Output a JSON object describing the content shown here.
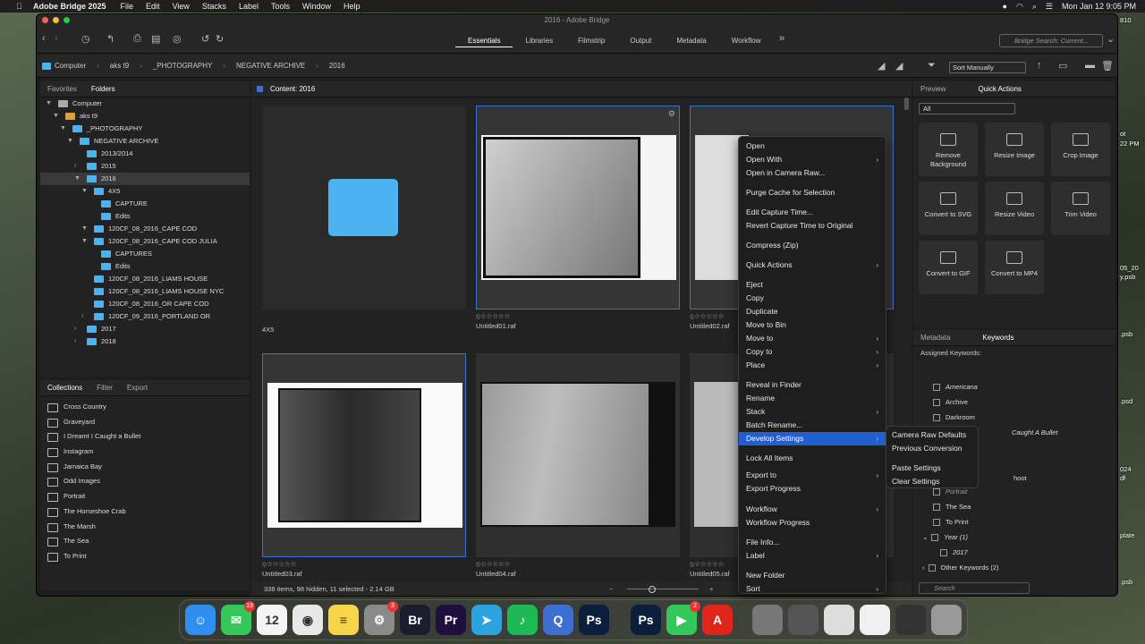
{
  "menubar": {
    "app_name": "Adobe Bridge 2025",
    "items": [
      "File",
      "Edit",
      "View",
      "Stacks",
      "Label",
      "Tools",
      "Window",
      "Help"
    ],
    "clock": "Mon Jan 12  9:05 PM"
  },
  "window": {
    "title": "2016 - Adobe Bridge"
  },
  "workspaces": [
    "Essentials",
    "Libraries",
    "Filmstrip",
    "Output",
    "Metadata",
    "Workflow"
  ],
  "search_placeholder": "Bridge Search: Current...",
  "breadcrumbs": [
    "Computer",
    "aks t9",
    "_PHOTOGRAPHY",
    "NEGATIVE ARCHIVE",
    "2016"
  ],
  "sort": {
    "label": "Sort Manually"
  },
  "left_tabs": [
    "Favorites",
    "Folders"
  ],
  "folders": [
    {
      "label": "Computer",
      "level": 0,
      "twisty": "▼"
    },
    {
      "label": "aks t9",
      "level": 1,
      "twisty": "▼"
    },
    {
      "label": "_PHOTOGRAPHY",
      "level": 2,
      "twisty": "▼"
    },
    {
      "label": "NEGATIVE ARCHIVE",
      "level": 3,
      "twisty": "▼"
    },
    {
      "label": "2013/2014",
      "level": 4,
      "twisty": ""
    },
    {
      "label": "2015",
      "level": 4,
      "twisty": "›"
    },
    {
      "label": "2016",
      "level": 4,
      "twisty": "▼",
      "selected": true
    },
    {
      "label": "4X5",
      "level": 5,
      "twisty": "▼"
    },
    {
      "label": "CAPTURE",
      "level": 6,
      "twisty": ""
    },
    {
      "label": "Edits",
      "level": 6,
      "twisty": ""
    },
    {
      "label": "120CF_08_2016_CAPE COD",
      "level": 5,
      "twisty": "▼"
    },
    {
      "label": "120CF_08_2016_CAPE COD JULIA",
      "level": 5,
      "twisty": "▼"
    },
    {
      "label": "CAPTURES",
      "level": 6,
      "twisty": ""
    },
    {
      "label": "Edits",
      "level": 6,
      "twisty": ""
    },
    {
      "label": "120CF_08_2016_LIAMS HOUSE",
      "level": 5,
      "twisty": ""
    },
    {
      "label": "120CF_08_2016_LIAMS HOUSE NYC",
      "level": 5,
      "twisty": ""
    },
    {
      "label": "120CF_08_2016_OR CAPE COD",
      "level": 5,
      "twisty": ""
    },
    {
      "label": "120CF_09_2016_PORTLAND OR",
      "level": 5,
      "twisty": "›"
    },
    {
      "label": "2017",
      "level": 4,
      "twisty": "›"
    },
    {
      "label": "2018",
      "level": 4,
      "twisty": "›"
    }
  ],
  "collection_tabs": [
    "Collections",
    "Filter",
    "Export"
  ],
  "collections": [
    "Cross Country",
    "Graveyard",
    "I Dreamt I Caught a Bullet",
    "Instagram",
    "Jamaica Bay",
    "Odd Images",
    "Portrait",
    "The Horseshoe Crab",
    "The Marsh",
    "The Sea",
    "To Print"
  ],
  "content_header": "Content: 2016",
  "thumbnails": [
    {
      "name": "4X5",
      "rating": ""
    },
    {
      "name": "Untitled01.raf",
      "rating": "⦸☆☆☆☆☆"
    },
    {
      "name": "Untitled02.raf",
      "rating": "⦸☆☆☆☆☆"
    },
    {
      "name": "Untitled03.raf",
      "rating": "⦸☆☆☆☆☆"
    },
    {
      "name": "Untitled04.raf",
      "rating": "⦸☆☆☆☆☆"
    },
    {
      "name": "Untitled05.raf",
      "rating": "⦸☆☆☆☆☆"
    }
  ],
  "status": "338 items, 98 hidden, 11 selected - 2.14 GB",
  "right_tabs": [
    "Preview",
    "Quick Actions"
  ],
  "quick_filter": "All",
  "quick_actions": [
    "Remove Background",
    "Resize Image",
    "Crop Image",
    "Convert to SVG",
    "Resize Video",
    "Trim Video",
    "Convert to GIF",
    "Convert to MP4"
  ],
  "kw_tabs": [
    "Metadata",
    "Keywords"
  ],
  "assigned_keywords": "Assigned Keywords:",
  "keywords": [
    "Americana",
    "Archive",
    "Darkroom",
    "Caught A Bullet",
    "hoot",
    "Portrait",
    "The Sea",
    "To Print",
    "Year  (1)",
    "2017",
    "Other Keywords  (2)"
  ],
  "kw_search": "Search",
  "context_menu": [
    {
      "label": "Open",
      "sub": false
    },
    {
      "label": "Open With",
      "sub": true
    },
    {
      "label": "Open in Camera Raw...",
      "sub": false
    },
    {
      "label": "Purge Cache for Selection",
      "sub": false
    },
    {
      "label": "Edit Capture Time...",
      "sub": false
    },
    {
      "label": "Revert Capture Time to Original",
      "sub": false
    },
    {
      "label": "Compress (Zip)",
      "sub": false
    },
    {
      "label": "Quick Actions",
      "sub": true
    },
    {
      "label": "Eject",
      "sub": false
    },
    {
      "label": "Copy",
      "sub": false
    },
    {
      "label": "Duplicate",
      "sub": false
    },
    {
      "label": "Move to Bin",
      "sub": false
    },
    {
      "label": "Move to",
      "sub": true
    },
    {
      "label": "Copy to",
      "sub": true
    },
    {
      "label": "Place",
      "sub": true
    },
    {
      "label": "Reveal in Finder",
      "sub": false
    },
    {
      "label": "Rename",
      "sub": false
    },
    {
      "label": "Stack",
      "sub": true
    },
    {
      "label": "Batch Rename...",
      "sub": false
    },
    {
      "label": "Develop Settings",
      "sub": true,
      "highlight": true
    },
    {
      "label": "Lock All Items",
      "sub": false
    },
    {
      "label": "Export to",
      "sub": true
    },
    {
      "label": "Export Progress",
      "sub": false
    },
    {
      "label": "Workflow",
      "sub": true
    },
    {
      "label": "Workflow Progress",
      "sub": false
    },
    {
      "label": "File Info...",
      "sub": false
    },
    {
      "label": "Label",
      "sub": true
    },
    {
      "label": "New Folder",
      "sub": false
    },
    {
      "label": "Sort",
      "sub": true
    }
  ],
  "submenu": [
    "Camera Raw Defaults",
    "Previous Conversion",
    "Paste Settings",
    "Clear Settings"
  ],
  "dock": [
    {
      "name": "Finder",
      "glyph": "☺",
      "color": "#2f8ef0"
    },
    {
      "name": "Messages",
      "glyph": "✉",
      "color": "#35c759",
      "badge": "19"
    },
    {
      "name": "Calendar",
      "glyph": "12",
      "color": "#f4f4f4"
    },
    {
      "name": "Chrome",
      "glyph": "◉",
      "color": "#e8e8e8"
    },
    {
      "name": "Notes",
      "glyph": "≡",
      "color": "#f7d54a"
    },
    {
      "name": "System Settings",
      "glyph": "⚙",
      "color": "#8a8a8a",
      "badge": "3"
    },
    {
      "name": "Bridge",
      "glyph": "Br",
      "color": "#1c1c2e"
    },
    {
      "name": "Premiere",
      "glyph": "Pr",
      "color": "#1f0f3d"
    },
    {
      "name": "Telegram",
      "glyph": "➤",
      "color": "#2aa3e0"
    },
    {
      "name": "Spotify",
      "glyph": "♪",
      "color": "#1db954"
    },
    {
      "name": "QuickTime",
      "glyph": "Q",
      "color": "#3d6fd0"
    },
    {
      "name": "Photoshop",
      "glyph": "Ps",
      "color": "#0b1f3d"
    },
    {
      "name": "Photoshop 2",
      "glyph": "Ps",
      "color": "#0b1f3d"
    },
    {
      "name": "FaceTime",
      "glyph": "▶",
      "color": "#35c759",
      "badge": "2"
    },
    {
      "name": "Acrobat",
      "glyph": "A",
      "color": "#e0251b"
    }
  ],
  "desktop_labels": [
    "ot",
    "22 PM",
    "05_20",
    "y.psb",
    ".psb",
    ".psd",
    "024",
    "df",
    "plate",
    ".psb",
    "810"
  ]
}
